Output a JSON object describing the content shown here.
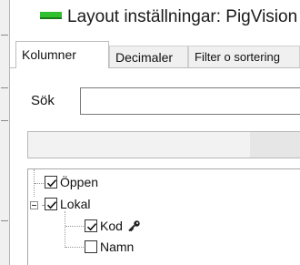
{
  "window": {
    "title": "Layout inställningar: PigVision"
  },
  "tabs": [
    {
      "label": "Kolumner",
      "active": true
    },
    {
      "label": "Decimaler",
      "active": false
    },
    {
      "label": "Filter o sortering",
      "active": false
    }
  ],
  "search": {
    "label": "Sök",
    "value": "",
    "placeholder": ""
  },
  "tree": {
    "nodes": [
      {
        "label": "Öppen",
        "checked": true,
        "expandable": false
      },
      {
        "label": "Lokal",
        "checked": true,
        "expandable": true,
        "expanded": true,
        "children": [
          {
            "label": "Kod",
            "checked": true,
            "icon": "key-icon"
          },
          {
            "label": "Namn",
            "checked": false
          }
        ]
      }
    ]
  },
  "colors": {
    "accent_icon": "#2fbf2f",
    "border": "#bdbdbd"
  }
}
